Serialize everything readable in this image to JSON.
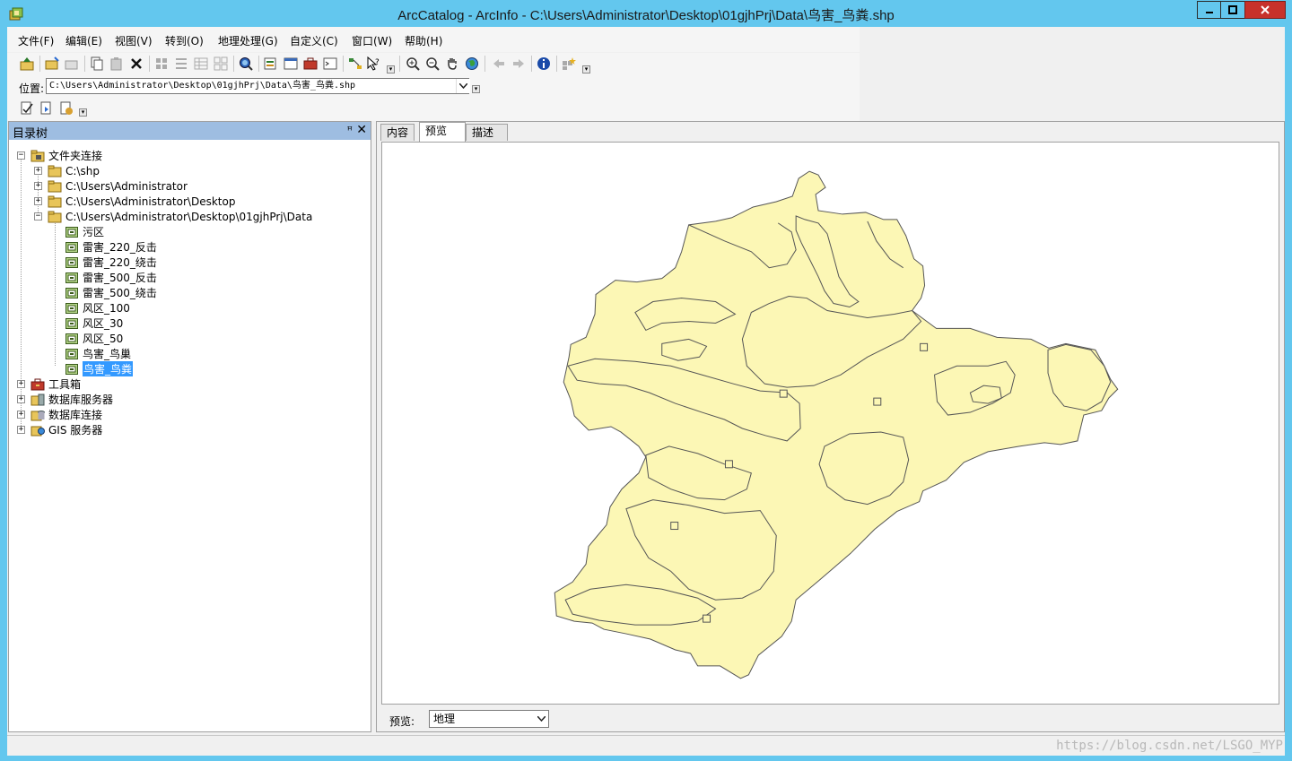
{
  "window": {
    "title": "ArcCatalog - ArcInfo - C:\\Users\\Administrator\\Desktop\\01gjhPrj\\Data\\鸟害_鸟粪.shp"
  },
  "menu": [
    "文件(F)",
    "编辑(E)",
    "视图(V)",
    "转到(O)",
    "地理处理(G)",
    "自定义(C)",
    "窗口(W)",
    "帮助(H)"
  ],
  "location": {
    "label": "位置:",
    "value": "C:\\Users\\Administrator\\Desktop\\01gjhPrj\\Data\\鸟害_鸟粪.shp"
  },
  "catalog": {
    "title": "目录树",
    "pin": "ꟸ",
    "close": "✕",
    "root": "文件夹连接",
    "folders": [
      "C:\\shp",
      "C:\\Users\\Administrator",
      "C:\\Users\\Administrator\\Desktop",
      "C:\\Users\\Administrator\\Desktop\\01gjhPrj\\Data"
    ],
    "files": [
      "污区",
      "雷害_220_反击",
      "雷害_220_绕击",
      "雷害_500_反击",
      "雷害_500_绕击",
      "风区_100",
      "风区_30",
      "风区_50",
      "鸟害_鸟巢",
      "鸟害_鸟粪"
    ],
    "selected_file": "鸟害_鸟粪",
    "other_nodes": [
      "工具箱",
      "数据库服务器",
      "数据库连接",
      "GIS 服务器"
    ]
  },
  "tabs": [
    "内容",
    "预览",
    "描述"
  ],
  "active_tab": "预览",
  "preview": {
    "label": "预览:",
    "type_value": "地理",
    "map_fill": "#fcf7b5",
    "map_stroke": "#555555"
  },
  "watermark": "https://blog.csdn.net/LSGO_MYP"
}
